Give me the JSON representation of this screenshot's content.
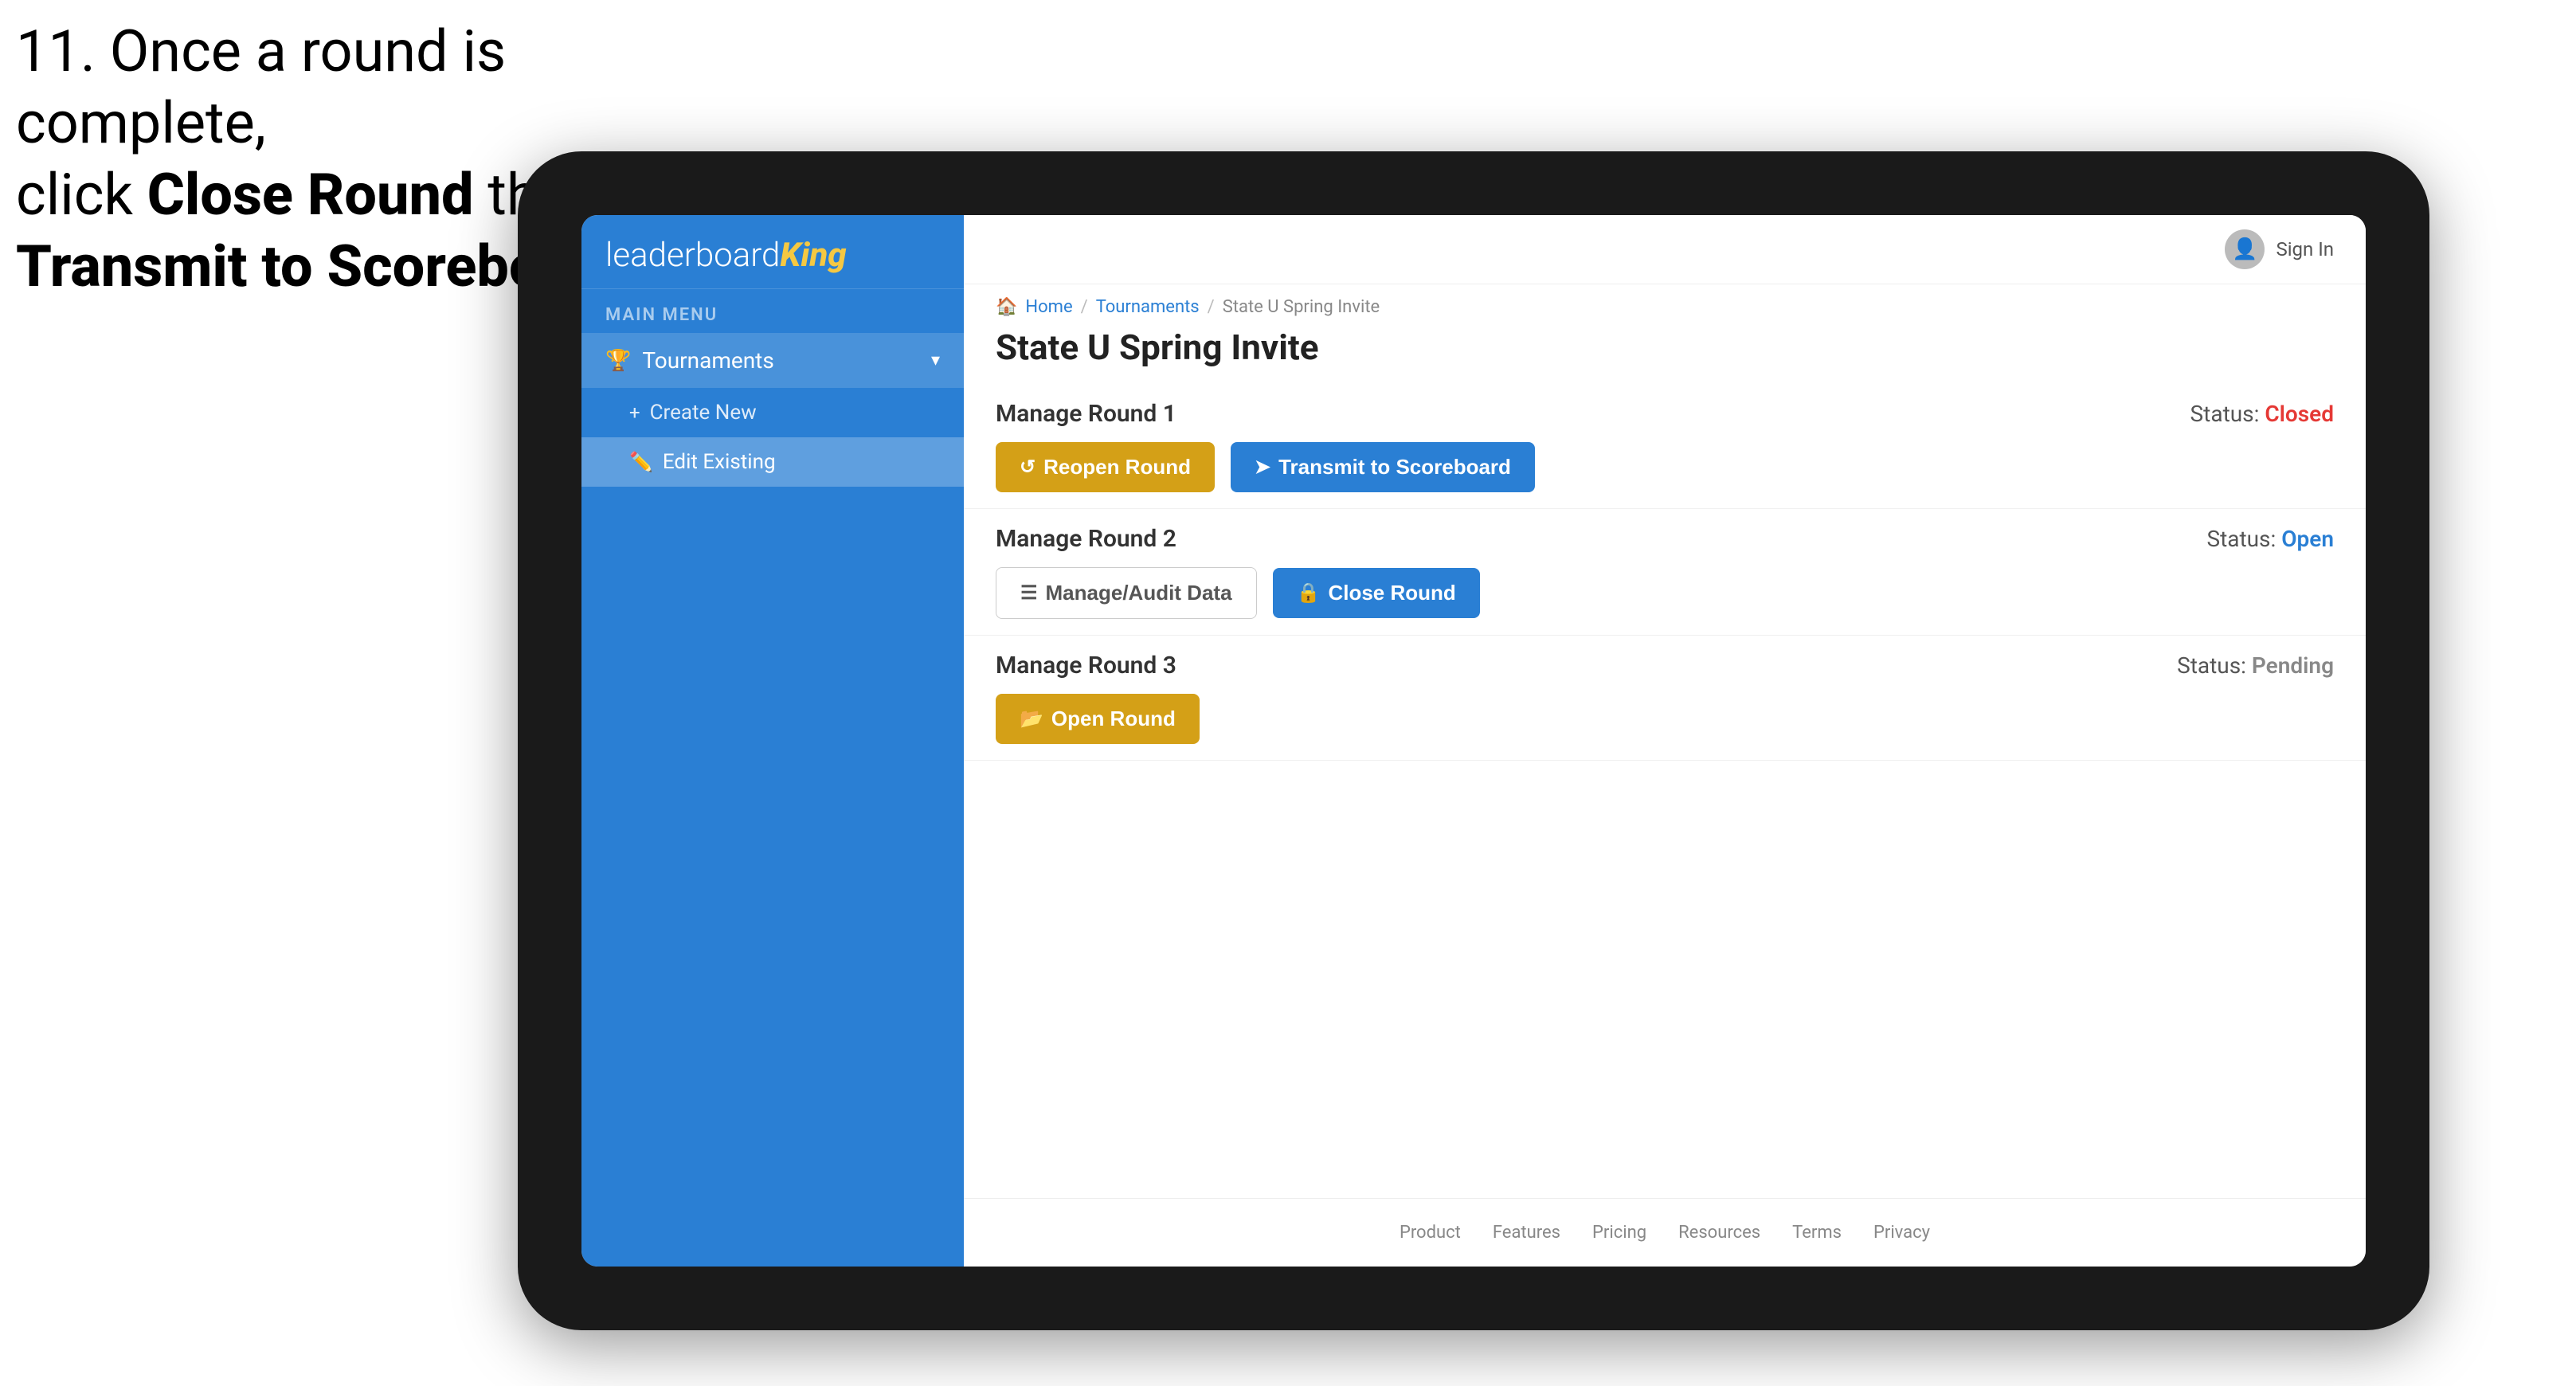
{
  "instruction": {
    "line1": "11. Once a round is complete,",
    "line2": "click ",
    "bold1": "Close Round",
    "line3": " then click",
    "bold2": "Transmit to Scoreboard."
  },
  "app": {
    "logo": {
      "leaderboard": "leaderboard",
      "king": "King"
    },
    "sidebar": {
      "main_menu_label": "MAIN MENU",
      "items": [
        {
          "id": "tournaments",
          "label": "Tournaments",
          "icon": "🏆",
          "expanded": true
        }
      ],
      "sub_items": [
        {
          "id": "create-new",
          "label": "Create New",
          "icon": "+"
        },
        {
          "id": "edit-existing",
          "label": "Edit Existing",
          "icon": "✏️",
          "selected": true
        }
      ]
    },
    "header": {
      "sign_in_label": "Sign In"
    },
    "breadcrumb": {
      "home": "Home",
      "sep": "/",
      "tournaments": "Tournaments",
      "current": "State U Spring Invite"
    },
    "page_title": "State U Spring Invite",
    "rounds": [
      {
        "id": "round1",
        "title": "Manage Round 1",
        "status_label": "Status:",
        "status": "Closed",
        "status_class": "status-closed",
        "buttons": [
          {
            "id": "reopen-round",
            "label": "Reopen Round",
            "icon": "↺",
            "style": "btn-gold"
          },
          {
            "id": "transmit-scoreboard",
            "label": "Transmit to Scoreboard",
            "icon": "➤",
            "style": "btn-blue"
          }
        ]
      },
      {
        "id": "round2",
        "title": "Manage Round 2",
        "status_label": "Status:",
        "status": "Open",
        "status_class": "status-open",
        "buttons": [
          {
            "id": "manage-audit-data",
            "label": "Manage/Audit Data",
            "icon": "☰",
            "style": "btn-outline"
          },
          {
            "id": "close-round",
            "label": "Close Round",
            "icon": "🔒",
            "style": "btn-blue"
          }
        ]
      },
      {
        "id": "round3",
        "title": "Manage Round 3",
        "status_label": "Status:",
        "status": "Pending",
        "status_class": "status-pending",
        "buttons": [
          {
            "id": "open-round",
            "label": "Open Round",
            "icon": "📂",
            "style": "btn-gold"
          }
        ]
      }
    ],
    "footer": {
      "links": [
        "Product",
        "Features",
        "Pricing",
        "Resources",
        "Terms",
        "Privacy"
      ]
    }
  }
}
